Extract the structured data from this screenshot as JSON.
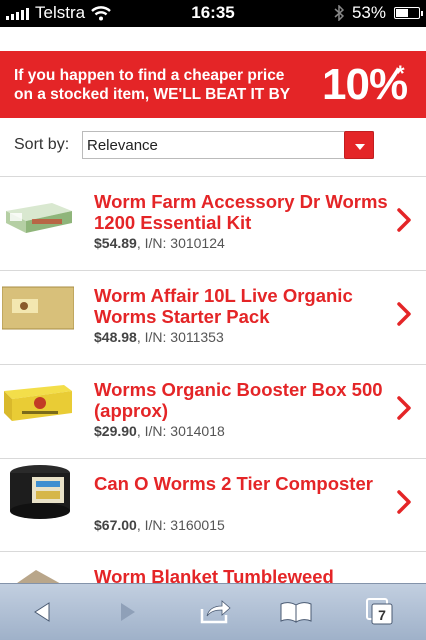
{
  "status": {
    "carrier": "Telstra",
    "time": "16:35",
    "battery": "53%",
    "battery_level": 0.53
  },
  "promo": {
    "line1": "If you happen to find a cheaper price",
    "line2": "on a stocked item, WE'LL BEAT IT BY",
    "percent": "10%",
    "mark": "*"
  },
  "sort": {
    "label": "Sort by:",
    "value": "Relevance"
  },
  "products": [
    {
      "title": "Worm Farm Accessory Dr Worms 1200 Essential Kit",
      "price": "$54.89",
      "sep": ", I/N: ",
      "item_number": "3010124"
    },
    {
      "title": "Worm Affair 10L Live Organic Worms Starter Pack",
      "price": "$48.98",
      "sep": ", I/N: ",
      "item_number": "3011353"
    },
    {
      "title": "Worms Organic Booster Box 500 (approx)",
      "price": "$29.90",
      "sep": ", I/N: ",
      "item_number": "3014018"
    },
    {
      "title": "Can O Worms 2 Tier Composter",
      "price": "$67.00",
      "sep": ", I/N: ",
      "item_number": "3160015"
    },
    {
      "title": "Worm Blanket Tumbleweed"
    }
  ],
  "toolbar": {
    "tabs_count": "7"
  },
  "colors": {
    "accent": "#e42527",
    "toolbar": "#b0c0d6"
  }
}
